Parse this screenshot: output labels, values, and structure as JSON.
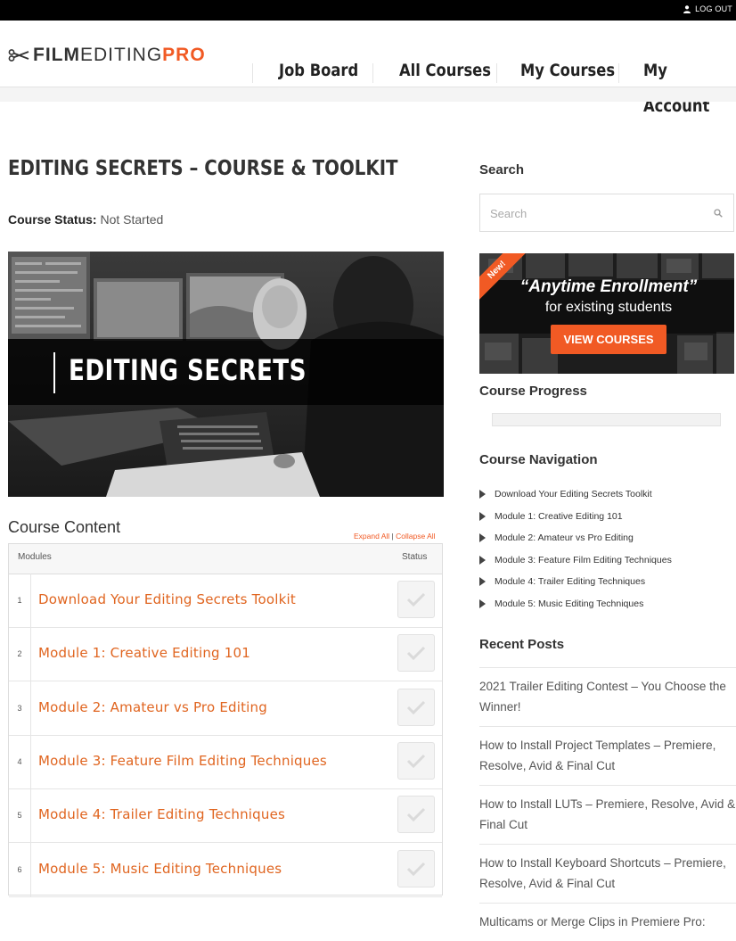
{
  "topbar": {
    "logout_label": "LOG OUT"
  },
  "logo": {
    "part1": "FILM",
    "part2": "EDITING",
    "part3": "PRO"
  },
  "nav": {
    "items": [
      "Job Board",
      "All Courses",
      "My Courses",
      "My Account"
    ]
  },
  "page": {
    "title": "EDITING SECRETS – COURSE & TOOLKIT",
    "status_label": "Course Status:",
    "status_value": "Not Started",
    "hero_title": "EDITING SECRETS"
  },
  "course_content": {
    "title": "Course Content",
    "expand_all": "Expand All",
    "separator": "|",
    "collapse_all": "Collapse All",
    "col_modules": "Modules",
    "col_status": "Status",
    "rows": [
      {
        "num": "1",
        "label": "Download Your Editing Secrets Toolkit"
      },
      {
        "num": "2",
        "label": "Module 1: Creative Editing 101"
      },
      {
        "num": "3",
        "label": "Module 2: Amateur vs Pro Editing"
      },
      {
        "num": "4",
        "label": "Module 3: Feature Film Editing Techniques"
      },
      {
        "num": "5",
        "label": "Module 4: Trailer Editing Techniques"
      },
      {
        "num": "6",
        "label": "Module 5: Music Editing Techniques"
      }
    ]
  },
  "sidebar": {
    "search_title": "Search",
    "search_placeholder": "Search",
    "banner": {
      "ribbon": "New!",
      "headline": "“Anytime Enrollment”",
      "subline": "for existing students",
      "button": "VIEW COURSES"
    },
    "progress_title": "Course Progress",
    "progress_fraction": 0,
    "nav_title": "Course Navigation",
    "nav_items": [
      "Download Your Editing Secrets Toolkit",
      "Module 1: Creative Editing 101",
      "Module 2: Amateur vs Pro Editing",
      "Module 3: Feature Film Editing Techniques",
      "Module 4: Trailer Editing Techniques",
      "Module 5: Music Editing Techniques"
    ],
    "recent_title": "Recent Posts",
    "recent_posts": [
      "2021 Trailer Editing Contest – You Choose the Winner!",
      "How to Install Project Templates – Premiere, Resolve, Avid & Final Cut",
      "How to Install LUTs – Premiere, Resolve, Avid & Final Cut",
      "How to Install Keyboard Shortcuts – Premiere, Resolve, Avid & Final Cut",
      "Multicams or Merge Clips in Premiere Pro:"
    ]
  },
  "colors": {
    "accent": "#f15a24",
    "link": "#e06520",
    "topbar": "#000000"
  }
}
